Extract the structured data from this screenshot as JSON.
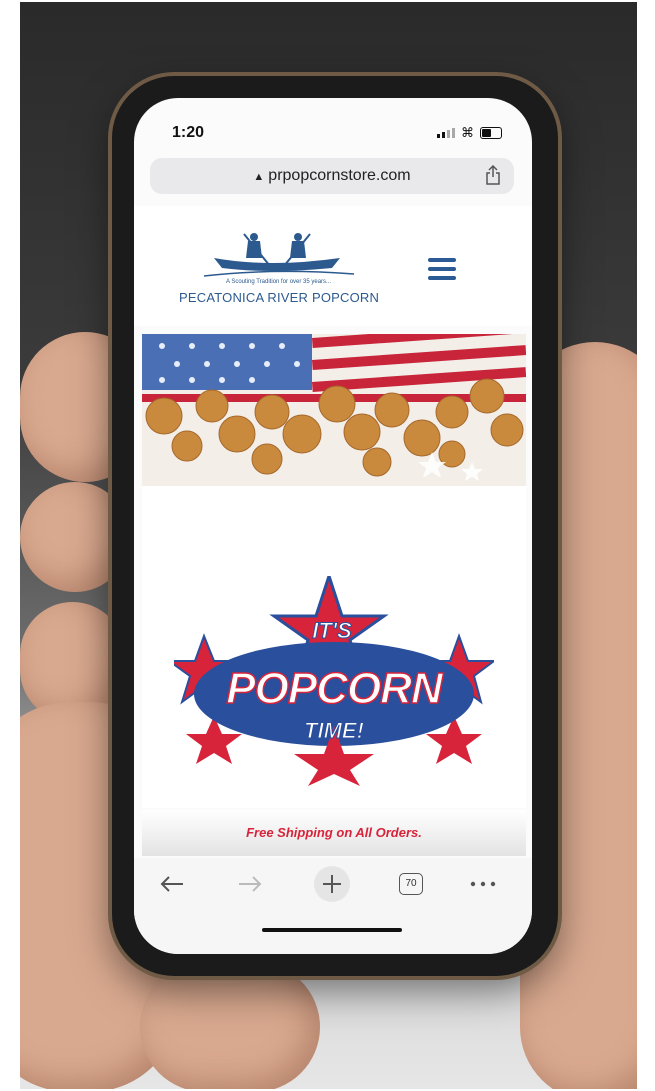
{
  "status": {
    "time": "1:20"
  },
  "browser": {
    "url": "prpopcornstore.com",
    "tabs_count": "70",
    "toolbar": [
      "back-icon",
      "forward-icon",
      "new-tab-icon",
      "tabs-icon",
      "more-icon"
    ]
  },
  "site": {
    "logo": {
      "tagline": "A Scouting Tradition for over 35 years...",
      "name": "PECATONICA RIVER POPCORN"
    },
    "promo": {
      "line1": "IT'S",
      "line2": "POPCORN",
      "line3": "TIME!"
    },
    "shipping_banner": "Free Shipping on All Orders."
  },
  "colors": {
    "brand_blue": "#2c5a8f",
    "promo_red": "#d7243b",
    "promo_blue": "#2a4f9c"
  }
}
